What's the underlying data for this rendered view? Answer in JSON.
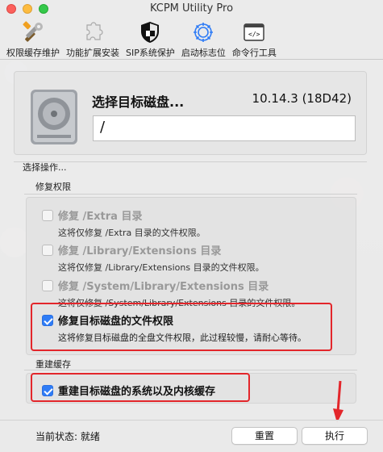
{
  "window": {
    "title": "KCPM Utility Pro"
  },
  "toolbar": {
    "items": [
      {
        "label": "权限缓存维护",
        "icon": "tools-icon"
      },
      {
        "label": "功能扩展安装",
        "icon": "puzzle-icon"
      },
      {
        "label": "SIP系统保护",
        "icon": "shield-icon"
      },
      {
        "label": "启动标志位",
        "icon": "gear-icon"
      },
      {
        "label": "命令行工具",
        "icon": "terminal-icon"
      }
    ]
  },
  "disk": {
    "title": "选择目标磁盘...",
    "version": "10.14.3 (18D42)",
    "path_value": "/"
  },
  "operations": {
    "label": "选择操作...",
    "repair_section": "修复权限",
    "options": [
      {
        "title": "修复 /Extra 目录",
        "desc": "这将仅修复 /Extra 目录的文件权限。",
        "checked": false,
        "enabled": false
      },
      {
        "title": "修复 /Library/Extensions 目录",
        "desc": "这将仅修复 /Library/Extensions 目录的文件权限。",
        "checked": false,
        "enabled": false
      },
      {
        "title": "修复 /System/Library/Extensions 目录",
        "desc": "这将仅修复 /System/Library/Extensions 目录的文件权限。",
        "checked": false,
        "enabled": false
      },
      {
        "title": "修复目标磁盘的文件权限",
        "desc": "这将修复目标磁盘的全盘文件权限，此过程较慢，请耐心等待。",
        "checked": true,
        "enabled": true
      }
    ],
    "cache_section": "重建缓存",
    "cache_option": {
      "title": "重建目标磁盘的系统以及内核缓存",
      "checked": true
    }
  },
  "status": {
    "text": "当前状态: 就绪",
    "reset_label": "重置",
    "execute_label": "执行"
  },
  "colors": {
    "accent": "#2f7cf6",
    "highlight": "#e3262b"
  }
}
